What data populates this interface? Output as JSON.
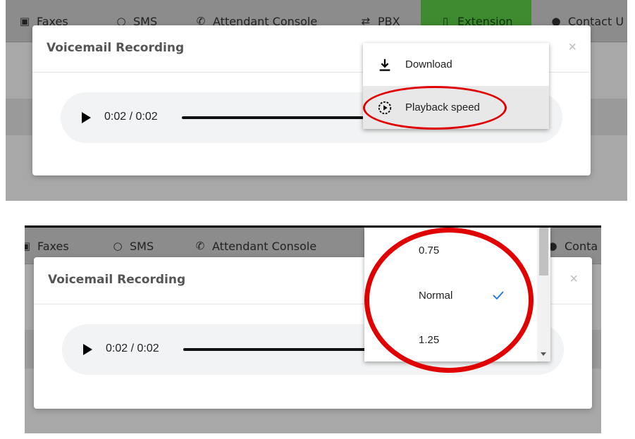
{
  "nav": {
    "faxes": "Faxes",
    "sms": "SMS",
    "attendant_console": "Attendant Console",
    "pbx": "PBX",
    "extension": "Extension",
    "contact_us": "Contact U",
    "contact_us_cropped": "Conta"
  },
  "modal": {
    "title": "Voicemail Recording",
    "close": "×"
  },
  "audio": {
    "time": "0:02 / 0:02"
  },
  "menu": {
    "download": "Download",
    "playback_speed": "Playback speed"
  },
  "speed_menu": {
    "options": [
      "0.75",
      "Normal",
      "1.25"
    ],
    "selected": "Normal"
  },
  "colors": {
    "active_tab": "#3e8a2e",
    "annotation": "#e00000",
    "check": "#1a73e8"
  }
}
